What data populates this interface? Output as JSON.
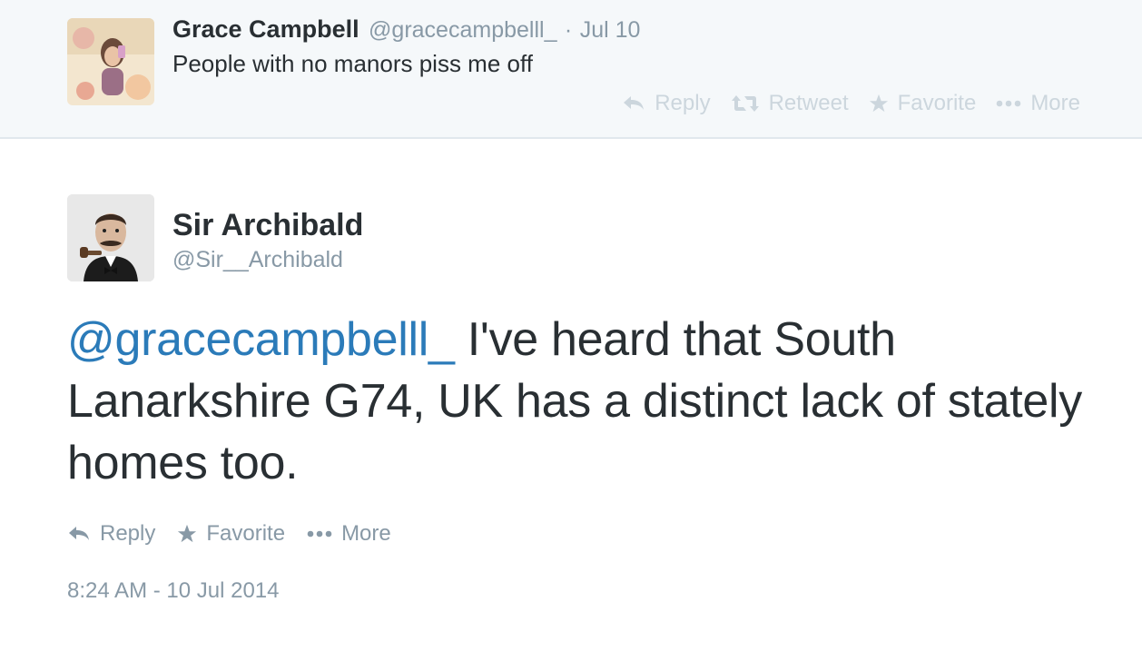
{
  "parent_tweet": {
    "avatar_icon": "user-photo-grace-campbell",
    "fullname": "Grace Campbell",
    "handle": "@gracecampbelll_",
    "separator": "·",
    "time": "Jul 10",
    "text": "People with no manors piss me off",
    "actions": {
      "reply": {
        "label": "Reply",
        "icon": "reply-icon"
      },
      "retweet": {
        "label": "Retweet",
        "icon": "retweet-icon"
      },
      "favorite": {
        "label": "Favorite",
        "icon": "star-icon"
      },
      "more": {
        "label": "More",
        "icon": "more-dots-icon"
      }
    }
  },
  "main_tweet": {
    "avatar_icon": "user-photo-sir-archibald",
    "fullname": "Sir Archibald",
    "handle": "@Sir__Archibald",
    "mention": "@gracecampbelll_",
    "text_rest": " I've heard that  South Lanarkshire G74, UK has a distinct lack of stately homes too.",
    "actions": {
      "reply": {
        "label": "Reply",
        "icon": "reply-icon"
      },
      "favorite": {
        "label": "Favorite",
        "icon": "star-icon"
      },
      "more": {
        "label": "More",
        "icon": "more-dots-icon"
      }
    },
    "timestamp": "8:24 AM - 10 Jul 2014"
  },
  "colors": {
    "link": "#2b7bb9",
    "muted": "#8899a6",
    "faded_action": "#ccd6dd",
    "text": "#292f33",
    "parent_background": "#f5f8fa"
  }
}
